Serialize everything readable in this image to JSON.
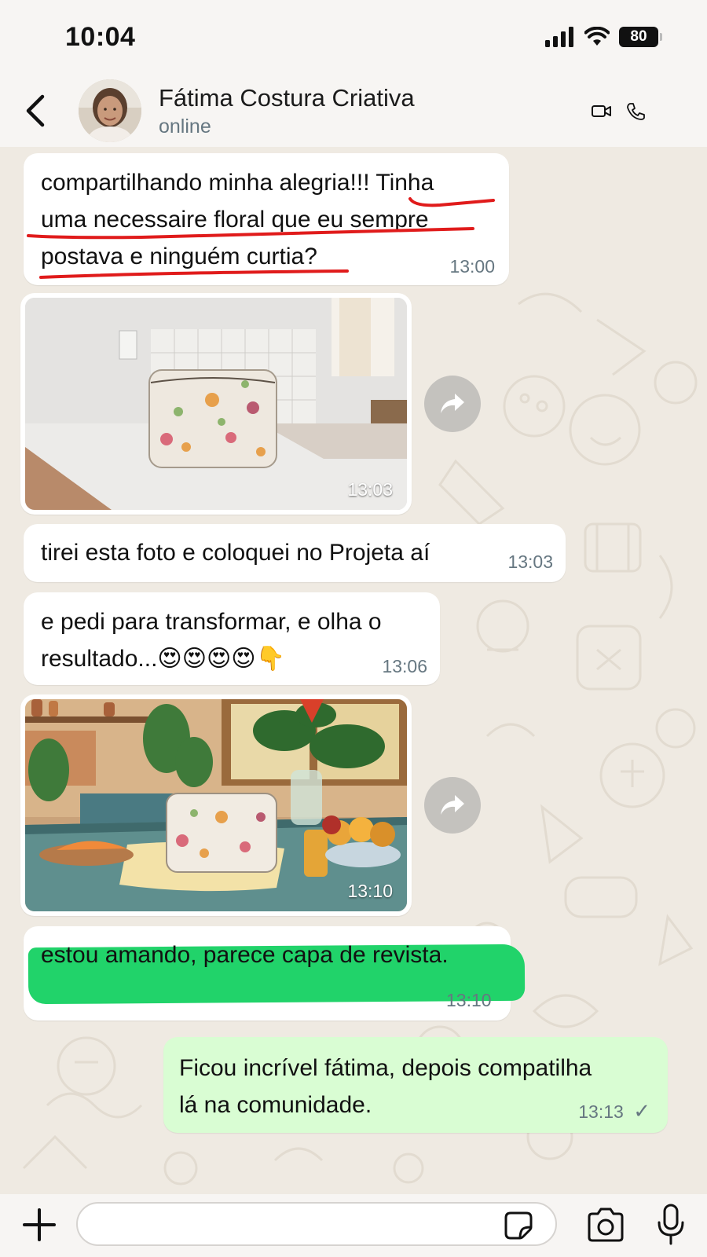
{
  "status_bar": {
    "time": "10:04",
    "battery": "80",
    "icons": [
      "signal-icon",
      "wifi-icon",
      "battery-icon"
    ]
  },
  "header": {
    "contact_name": "Fátima Costura Criativa",
    "contact_status": "online",
    "icons": [
      "back-icon",
      "video-call-icon",
      "voice-call-icon"
    ]
  },
  "messages": [
    {
      "type": "text",
      "direction": "incoming",
      "lines": [
        "compartilhando minha alegria!!! Tinha",
        "uma necessaire floral que eu sempre",
        "postava e ninguém curtia?"
      ],
      "time": "13:00",
      "annotation": "red underline"
    },
    {
      "type": "image",
      "direction": "incoming",
      "description": "floral bag on kitchen counter",
      "time": "13:03"
    },
    {
      "type": "text",
      "direction": "incoming",
      "lines": [
        "tirei esta foto e coloquei no Projeta aí"
      ],
      "time": "13:03"
    },
    {
      "type": "text",
      "direction": "incoming",
      "lines": [
        "e pedi para transformar, e olha o",
        "resultado...😍😍😍😍👇"
      ],
      "time": "13:06"
    },
    {
      "type": "image",
      "direction": "incoming",
      "description": "floral bag styled on rustic table with plants and fruit",
      "time": "13:10"
    },
    {
      "type": "text",
      "direction": "incoming",
      "lines": [
        "estou amando, parece capa de revista."
      ],
      "time": "13:10",
      "annotation": "green highlight"
    },
    {
      "type": "text",
      "direction": "outgoing",
      "lines": [
        "Ficou incrível fátima, depois compatilha",
        "lá na comunidade."
      ],
      "time": "13:13",
      "status": "✓"
    }
  ],
  "input_bar": {
    "placeholder": "",
    "icons": [
      "plus-icon",
      "sticker-icon",
      "camera-icon",
      "microphone-icon"
    ]
  },
  "colors": {
    "chat_background": "#efeae2",
    "incoming_bubble": "#ffffff",
    "outgoing_bubble": "#d9fdd3",
    "highlight": "#21d36a",
    "annotation_red": "#e01b1b"
  }
}
